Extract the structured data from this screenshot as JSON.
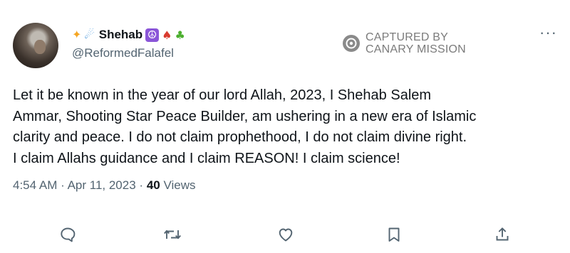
{
  "user": {
    "lead_emojis": [
      "star-emoji",
      "comet-emoji"
    ],
    "display_name": "Shehab",
    "trailing_emojis": [
      "peace-symbol-emoji",
      "mushroom-emoji",
      "seedling-emoji"
    ],
    "handle": "@ReformedFalafel"
  },
  "watermark": {
    "line1": "CAPTURED BY",
    "line2": "CANARY MISSION"
  },
  "more_icon": "more-dots-icon",
  "tweet": {
    "text": "Let it be known in the year of our lord Allah, 2023, I Shehab Salem\nAmmar, Shooting Star Peace Builder, am ushering in a new era of Islamic\nclarity and peace. I do not claim prophethood, I do not claim divine right.\nI claim Allahs guidance and I claim REASON! I claim science!",
    "time": "4:54 AM",
    "date": "Apr 11, 2023",
    "sep": "·",
    "views_count": "40",
    "views_label": "Views"
  },
  "actions": [
    "reply-icon",
    "retweet-icon",
    "like-icon",
    "bookmark-icon",
    "share-icon"
  ],
  "colors": {
    "text": "#0f1419",
    "secondary": "#536471",
    "watermark": "#808080"
  }
}
